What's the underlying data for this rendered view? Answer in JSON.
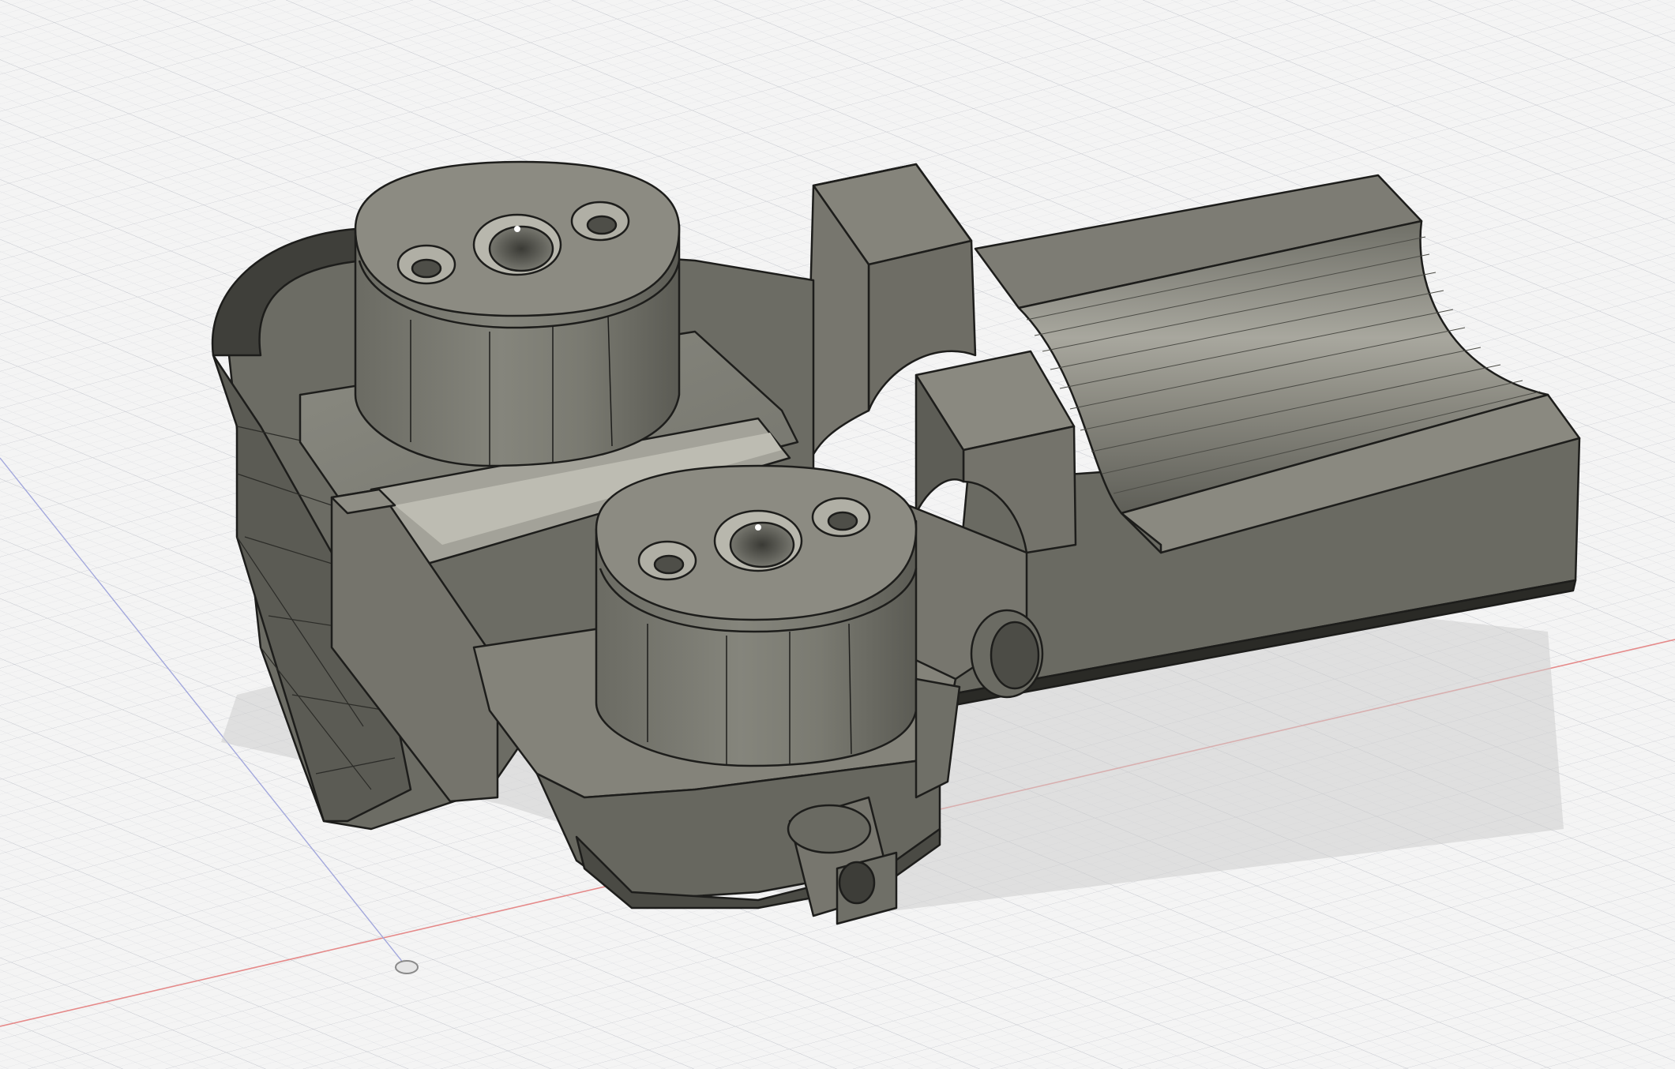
{
  "viewport": {
    "background": "#f4f4f4",
    "grid_minor_color": "#e2e3e6",
    "grid_major_color": "#cfd1d6",
    "x_axis_color": "#e58a8a",
    "z_axis_color": "#9aa0d6",
    "body_color": "#7a7a72",
    "body_dark_color": "#4e4e48",
    "body_light_color": "#a5a49b",
    "edge_color": "#1d1d1b",
    "shadow_color": "#cfcfcf"
  },
  "model": {
    "icons": [
      "origin-point-icon"
    ]
  }
}
